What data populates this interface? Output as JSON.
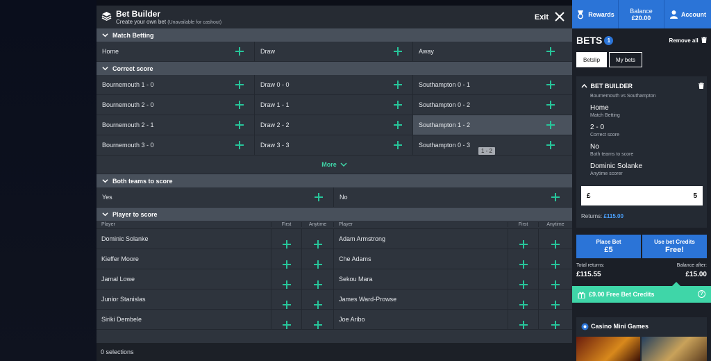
{
  "modal": {
    "title": "Bet Builder",
    "subtitle": "Create your own bet",
    "subtitle_note": "(Unavailable for cashout)",
    "exit_label": "Exit"
  },
  "match_betting": {
    "title": "Match Betting",
    "options": [
      "Home",
      "Draw",
      "Away"
    ]
  },
  "correct_score": {
    "title": "Correct score",
    "rows": [
      [
        "Bournemouth 1 - 0",
        "Draw 0 - 0",
        "Southampton 0 - 1"
      ],
      [
        "Bournemouth 2 - 0",
        "Draw 1 - 1",
        "Southampton 0 - 2"
      ],
      [
        "Bournemouth 2 - 1",
        "Draw 2 - 2",
        "Southampton 1 - 2"
      ],
      [
        "Bournemouth 3 - 0",
        "Draw 3 - 3",
        "Southampton 0 - 3"
      ]
    ],
    "tooltip": "1 - 2",
    "more_label": "More"
  },
  "btts": {
    "title": "Both teams to score",
    "options": [
      "Yes",
      "No"
    ]
  },
  "player_to_score": {
    "title": "Player to score",
    "headers": {
      "player": "Player",
      "first": "First",
      "anytime": "Anytime"
    },
    "rows": [
      [
        "Dominic Solanke",
        "Adam Armstrong"
      ],
      [
        "Kieffer Moore",
        "Che Adams"
      ],
      [
        "Jamal Lowe",
        "Sekou Mara"
      ],
      [
        "Junior Stanislas",
        "James Ward-Prowse"
      ],
      [
        "Siriki Dembele",
        "Joe Aribo"
      ]
    ]
  },
  "footer": {
    "selections": "0 selections"
  },
  "topbar": {
    "rewards": "Rewards",
    "balance_label": "Balance",
    "balance_value": "£20.00",
    "account": "Account"
  },
  "betslip": {
    "title": "BETS",
    "count": "1",
    "remove_all": "Remove all",
    "tabs": [
      "Betslip",
      "My bets"
    ],
    "builder_title": "BET BUILDER",
    "fixture": "Bournemouth vs Southampton",
    "selections": [
      {
        "pick": "Home",
        "market": "Match Betting"
      },
      {
        "pick": "2 - 0",
        "market": "Correct score"
      },
      {
        "pick": "No",
        "market": "Both teams to score"
      },
      {
        "pick": "Dominic Solanke",
        "market": "Anytime scorer"
      }
    ],
    "currency": "£",
    "stake": "5",
    "returns_label": "Returns:",
    "returns_value": "£115.00",
    "place_bet_label": "Place Bet",
    "place_bet_value": "£5",
    "credits_label": "Use bet Credits",
    "credits_value": "Free!",
    "total_returns_label": "Total returns:",
    "total_returns_value": "£115.55",
    "balance_after_label": "Balance after:",
    "balance_after_value": "£15.00",
    "free_credits": "£9.00 Free Bet Credits",
    "casino_title": "Casino Mini Games"
  },
  "colors": {
    "accent_green": "#27c59a",
    "brand_blue": "#2b74d7",
    "free_credits_bg": "#3fd6a8"
  }
}
